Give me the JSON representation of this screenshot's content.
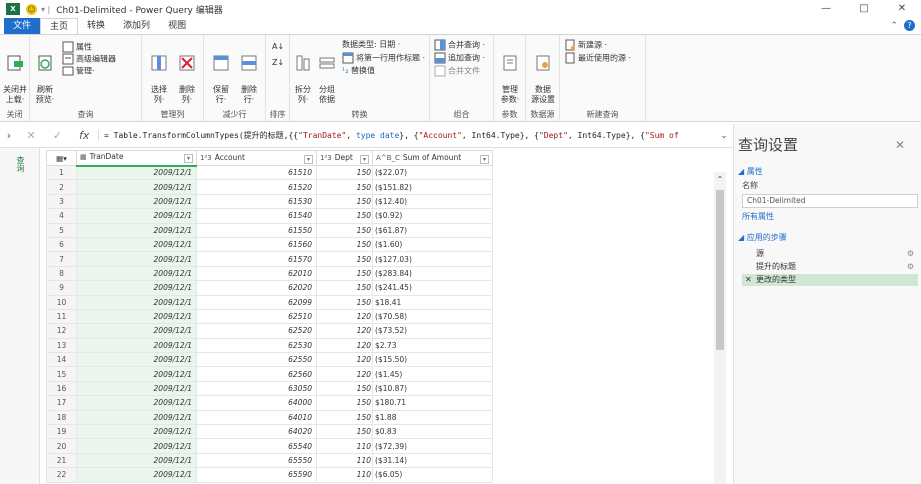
{
  "window": {
    "app_icon": "X",
    "title": "Ch01-Delimited - Power Query 编辑器",
    "minimize": "—",
    "maximize": "□",
    "close": "✕"
  },
  "tabs": [
    {
      "label": "文件"
    },
    {
      "label": "主页"
    },
    {
      "label": "转换"
    },
    {
      "label": "添加列"
    },
    {
      "label": "视图"
    }
  ],
  "ribbon": {
    "close_group": {
      "btn": "关闭并\n上载·",
      "label": "关闭"
    },
    "query_group": {
      "refresh": "刷新\n预览·",
      "props": "属性",
      "adv": "高级编辑器",
      "manage": "管理·",
      "label": "查询"
    },
    "managecol_group": {
      "select": "选择\n列·",
      "remove": "删除\n列·",
      "label": "管理列"
    },
    "reducerows_group": {
      "keep": "保留\n行·",
      "remove": "删除\n行·",
      "label": "减少行"
    },
    "sort_group": {
      "label": "排序"
    },
    "transform_group": {
      "split": "拆分\n列·",
      "group": "分组\n依据",
      "datatype": "数据类型: 日期 ·",
      "firstrow": "将第一行用作标题 ·",
      "replace": "替换值",
      "label": "转换"
    },
    "combine_group": {
      "merge": "合并查询 ·",
      "append": "追加查询 ·",
      "combine": "合并文件",
      "label": "组合"
    },
    "params_group": {
      "manage": "管理\n参数·",
      "label": "参数"
    },
    "datasource_group": {
      "settings": "数据\n源设置",
      "label": "数据源"
    },
    "newquery_group": {
      "newsource": "新建源 ·",
      "recent": "最近使用的源 ·",
      "label": "新建查询"
    }
  },
  "formula": {
    "expand": "›",
    "cancel": "✕",
    "confirm": "✓",
    "fx": "fx",
    "prefix": "= Table.TransformColumnTypes(提升的标题,{{",
    "s1": "\"TranDate\"",
    "k1": "type date",
    "m1": "}, {",
    "s2": "\"Account\"",
    "m2": ", Int64.Type}, {",
    "s3": "\"Dept\"",
    "m3": ", Int64.Type}, {",
    "s4": "\"Sum of",
    "dropdown": "⌄"
  },
  "leftstrip": {
    "label": "查询"
  },
  "grid": {
    "columns": [
      {
        "icon": "▦",
        "name": "TranDate"
      },
      {
        "icon": "1²3",
        "name": "Account"
      },
      {
        "icon": "1²3",
        "name": "Dept"
      },
      {
        "icon": "A^B_C",
        "name": "Sum of Amount"
      }
    ],
    "rows": [
      [
        "1",
        "2009/12/1",
        "61510",
        "150",
        "($22.07)"
      ],
      [
        "2",
        "2009/12/1",
        "61520",
        "150",
        "($151.82)"
      ],
      [
        "3",
        "2009/12/1",
        "61530",
        "150",
        "($12.40)"
      ],
      [
        "4",
        "2009/12/1",
        "61540",
        "150",
        "($0.92)"
      ],
      [
        "5",
        "2009/12/1",
        "61550",
        "150",
        "($61.87)"
      ],
      [
        "6",
        "2009/12/1",
        "61560",
        "150",
        "($1.60)"
      ],
      [
        "7",
        "2009/12/1",
        "61570",
        "150",
        "($127.03)"
      ],
      [
        "8",
        "2009/12/1",
        "62010",
        "150",
        "($283.84)"
      ],
      [
        "9",
        "2009/12/1",
        "62020",
        "150",
        "($241.45)"
      ],
      [
        "10",
        "2009/12/1",
        "62099",
        "150",
        "$18.41"
      ],
      [
        "11",
        "2009/12/1",
        "62510",
        "120",
        "($70.58)"
      ],
      [
        "12",
        "2009/12/1",
        "62520",
        "120",
        "($73.52)"
      ],
      [
        "13",
        "2009/12/1",
        "62530",
        "120",
        "$2.73"
      ],
      [
        "14",
        "2009/12/1",
        "62550",
        "120",
        "($15.50)"
      ],
      [
        "15",
        "2009/12/1",
        "62560",
        "120",
        "($1.45)"
      ],
      [
        "16",
        "2009/12/1",
        "63050",
        "150",
        "($10.87)"
      ],
      [
        "17",
        "2009/12/1",
        "64000",
        "150",
        "$180.71"
      ],
      [
        "18",
        "2009/12/1",
        "64010",
        "150",
        "$1.88"
      ],
      [
        "19",
        "2009/12/1",
        "64020",
        "150",
        "$0.83"
      ],
      [
        "20",
        "2009/12/1",
        "65540",
        "110",
        "($72.39)"
      ],
      [
        "21",
        "2009/12/1",
        "65550",
        "110",
        "($31.14)"
      ],
      [
        "22",
        "2009/12/1",
        "65590",
        "110",
        "($6.05)"
      ]
    ]
  },
  "query_settings": {
    "title": "查询设置",
    "close": "✕",
    "properties_header": "◢ 属性",
    "name_label": "名称",
    "name_value": "Ch01-Delimited",
    "all_props": "所有属性",
    "steps_header": "◢ 应用的步骤",
    "steps": [
      "源",
      "提升的标题",
      "更改的类型"
    ]
  }
}
